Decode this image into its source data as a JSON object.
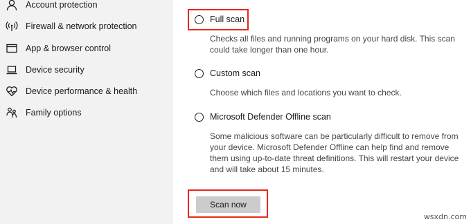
{
  "sidebar": {
    "items": [
      {
        "label": "Account protection",
        "icon": "person-icon"
      },
      {
        "label": "Firewall & network protection",
        "icon": "wifi-antenna-icon"
      },
      {
        "label": "App & browser control",
        "icon": "browser-window-icon"
      },
      {
        "label": "Device security",
        "icon": "laptop-icon"
      },
      {
        "label": "Device performance & health",
        "icon": "heart-pulse-icon"
      },
      {
        "label": "Family options",
        "icon": "family-icon"
      }
    ]
  },
  "scan_options": {
    "full": {
      "label": "Full scan",
      "description": "Checks all files and running programs on your hard disk. This scan could take longer than one hour.",
      "selected": false
    },
    "custom": {
      "label": "Custom scan",
      "description": "Choose which files and locations you want to check.",
      "selected": false
    },
    "offline": {
      "label": "Microsoft Defender Offline scan",
      "description": "Some malicious software can be particularly difficult to remove from your device. Microsoft Defender Offline can help find and remove them using up-to-date threat definitions. This will restart your device and will take about 15 minutes.",
      "selected": false
    }
  },
  "actions": {
    "scan_now_label": "Scan now"
  },
  "watermark": "wsxdn.com",
  "colors": {
    "sidebar_bg": "#f2f2f2",
    "highlight": "#e8261a",
    "button_bg": "#cccccc"
  }
}
